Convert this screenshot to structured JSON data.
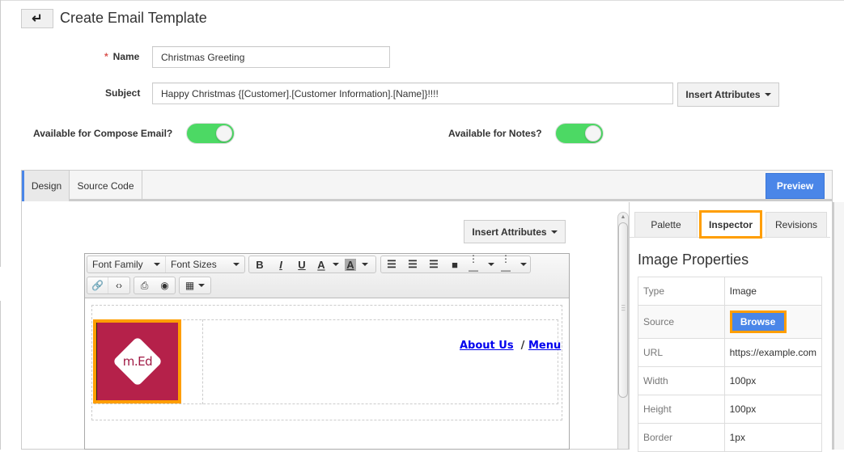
{
  "header": {
    "back_icon": "arrow-back-icon",
    "title": "Create Email Template"
  },
  "form": {
    "name_required_mark": "*",
    "name_label": "Name",
    "name_value": "Christmas Greeting",
    "subject_label": "Subject",
    "subject_value": "Happy Christmas {[Customer].[Customer Information].[Name]}!!!!",
    "insert_attributes_label": "Insert Attributes",
    "compose_label": "Available for Compose Email?",
    "compose_enabled": true,
    "notes_label": "Available for Notes?",
    "notes_enabled": true
  },
  "editor": {
    "tabs": [
      {
        "label": "Design",
        "active": true
      },
      {
        "label": "Source Code",
        "active": false
      }
    ],
    "preview_label": "Preview",
    "canvas_insert_attributes_label": "Insert Attributes",
    "toolbar": {
      "font_family": "Font Family",
      "font_sizes": "Font Sizes",
      "bold": "B",
      "italic": "I",
      "underline": "U",
      "font_color": "A",
      "background_color": "A",
      "icons": [
        "bold-icon",
        "italic-icon",
        "underline-icon",
        "font-color-icon",
        "background-color-icon",
        "align-left-icon",
        "align-center-icon",
        "align-right-icon",
        "align-justify-icon",
        "bullet-list-icon",
        "numbered-list-icon",
        "link-icon",
        "code-icon",
        "print-icon",
        "preview-eye-icon",
        "table-icon"
      ]
    },
    "content": {
      "logo_text": "m.Ed",
      "logo_color": "#b5214a",
      "link_about": "About Us",
      "link_separator": "/",
      "link_menu": "Menu"
    }
  },
  "side_panel": {
    "tabs": [
      {
        "label": "Palette",
        "active": false
      },
      {
        "label": "Inspector",
        "active": true
      },
      {
        "label": "Revisions",
        "active": false
      }
    ],
    "title": "Image Properties",
    "properties": [
      {
        "key": "Type",
        "value": "Image"
      },
      {
        "key": "Source",
        "value": "Browse"
      },
      {
        "key": "URL",
        "value": "https://example.com"
      },
      {
        "key": "Width",
        "value": "100px"
      },
      {
        "key": "Height",
        "value": "100px"
      },
      {
        "key": "Border",
        "value": "1px"
      }
    ]
  },
  "colors": {
    "accent_blue": "#4a86e8",
    "highlight_orange": "#ff9e00",
    "toggle_green": "#4cd964"
  }
}
